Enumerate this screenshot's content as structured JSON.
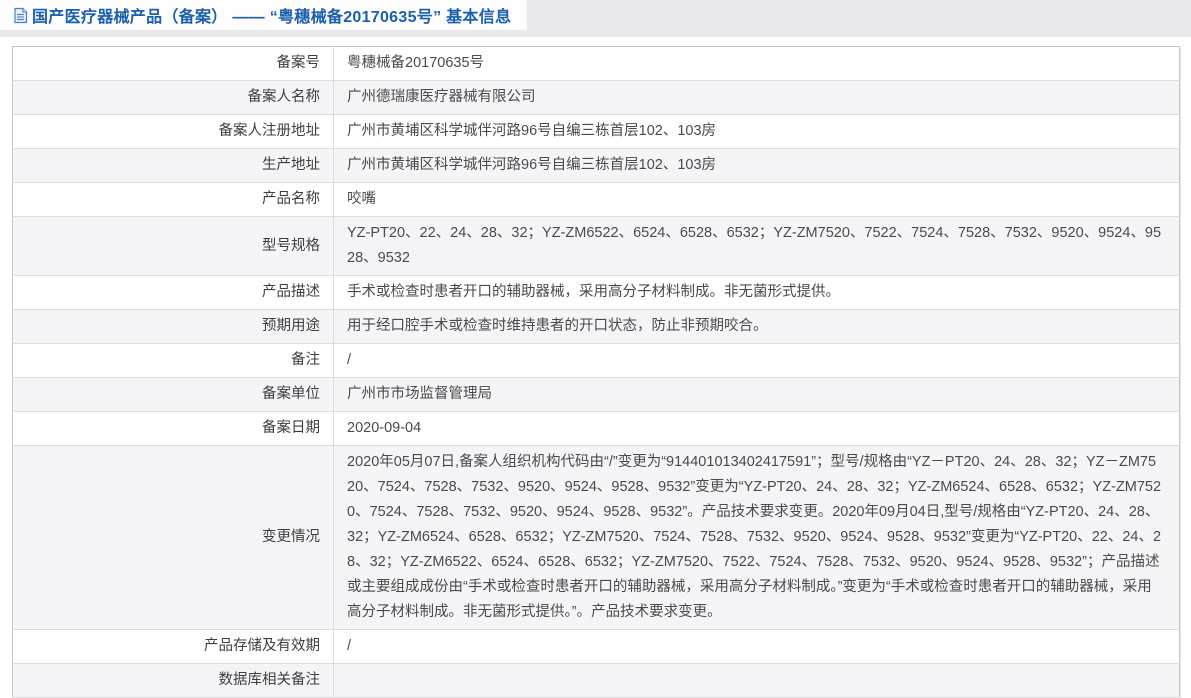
{
  "header": {
    "icon": "document-icon",
    "title": "国产医疗器械产品（备案） —— “粤穗械备20170635号” 基本信息"
  },
  "table": {
    "rows": [
      {
        "label": "备案号",
        "value": "粤穗械备20170635号"
      },
      {
        "label": "备案人名称",
        "value": "广州德瑞康医疗器械有限公司"
      },
      {
        "label": "备案人注册地址",
        "value": "广州市黄埔区科学城伴河路96号自编三栋首层102、103房"
      },
      {
        "label": "生产地址",
        "value": "广州市黄埔区科学城伴河路96号自编三栋首层102、103房"
      },
      {
        "label": "产品名称",
        "value": "咬嘴"
      },
      {
        "label": "型号规格",
        "value": "YZ-PT20、22、24、28、32；YZ-ZM6522、6524、6528、6532；YZ-ZM7520、7522、7524、7528、7532、9520、9524、9528、9532"
      },
      {
        "label": "产品描述",
        "value": "手术或检查时患者开口的辅助器械，采用高分子材料制成。非无菌形式提供。"
      },
      {
        "label": "预期用途",
        "value": "用于经口腔手术或检查时维持患者的开口状态，防止非预期咬合。"
      },
      {
        "label": "备注",
        "value": "/"
      },
      {
        "label": "备案单位",
        "value": "广州市市场监督管理局"
      },
      {
        "label": "备案日期",
        "value": "2020-09-04"
      },
      {
        "label": "变更情况",
        "value": "2020年05月07日,备案人组织机构代码由“/”变更为“914401013402417591”；型号/规格由“YZ－PT20、24、28、32；YZ－ZM7520、7524、7528、7532、9520、9524、9528、9532”变更为“YZ-PT20、24、28、32；YZ-ZM6524、6528、6532；YZ-ZM7520、7524、7528、7532、9520、9524、9528、9532”。产品技术要求变更。2020年09月04日,型号/规格由“YZ-PT20、24、28、32；YZ-ZM6524、6528、6532；YZ-ZM7520、7524、7528、7532、9520、9524、9528、9532”变更为“YZ-PT20、22、24、28、32；YZ-ZM6522、6524、6528、6532；YZ-ZM7520、7522、7524、7528、7532、9520、9524、9528、9532”；产品描述或主要组成成份由“手术或检查时患者开口的辅助器械，采用高分子材料制成。”变更为“手术或检查时患者开口的辅助器械，采用高分子材料制成。非无菌形式提供。”。产品技术要求变更。"
      },
      {
        "label": "产品存储及有效期",
        "value": "/"
      },
      {
        "label": "数据库相关备注",
        "value": ""
      }
    ]
  },
  "colors": {
    "title_blue": "#1b5fae",
    "header_strip_bg": "#e9e9ec",
    "row_alt_bg": "#f5f5f7",
    "table_border": "#c6c6c9",
    "row_divider": "#dddde0",
    "label_text": "#3e3e40",
    "value_text": "#4a4a4c"
  }
}
